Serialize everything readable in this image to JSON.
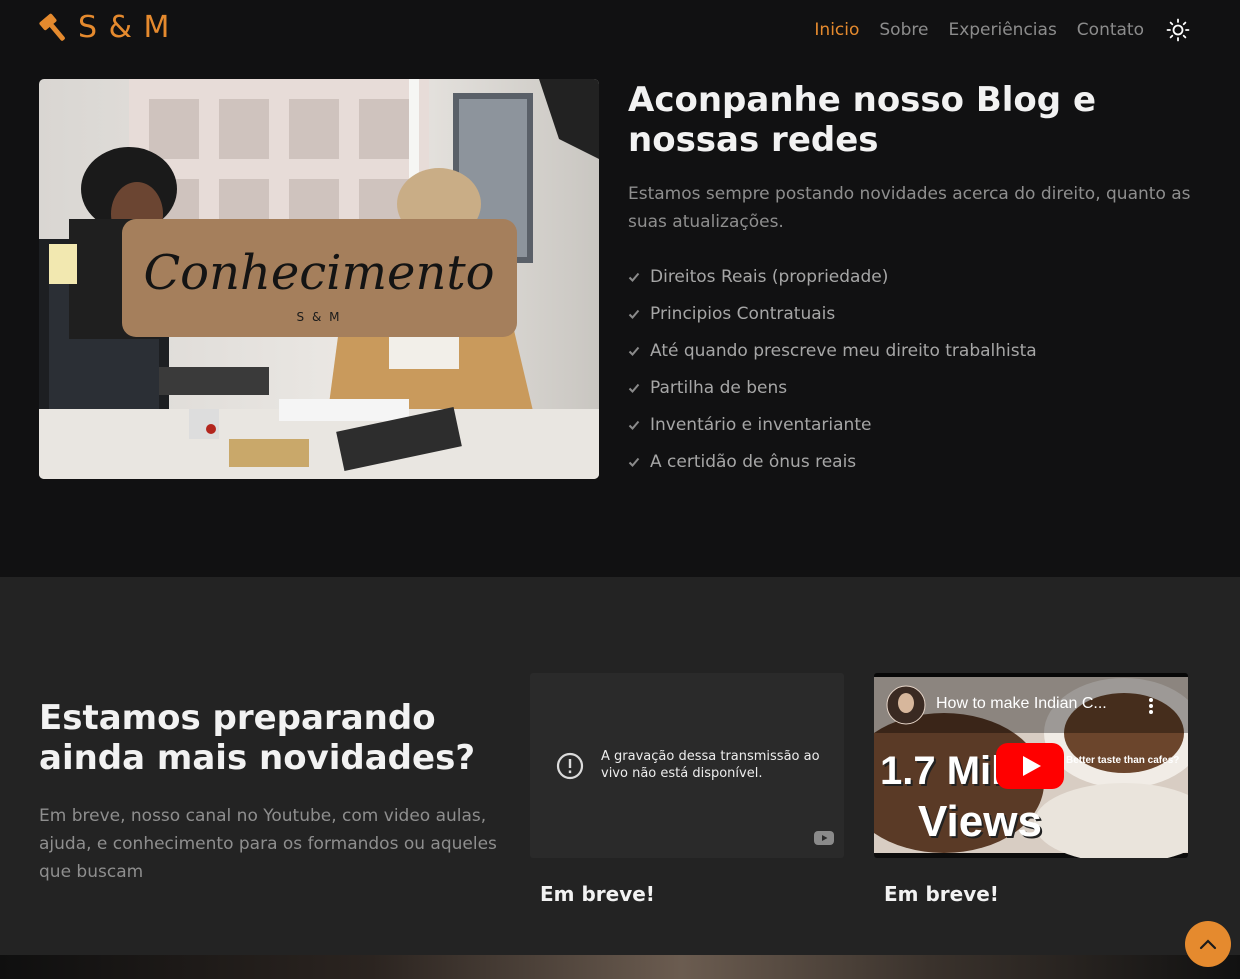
{
  "nav": {
    "logo_text": "S & M",
    "items": [
      {
        "label": "Inicio",
        "active": true
      },
      {
        "label": "Sobre",
        "active": false
      },
      {
        "label": "Experiências",
        "active": false
      },
      {
        "label": "Contato",
        "active": false
      }
    ],
    "theme_icon": "sun-icon"
  },
  "blog": {
    "image_card": {
      "script_text": "Conhecimento",
      "brand": "S & M"
    },
    "title": "Aconpanhe nosso Blog e nossas redes",
    "description": "Estamos sempre postando novidades acerca do direito, quanto as suas atualizações.",
    "topics": [
      "Direitos Reais (propriedade)",
      "Principios Contratuais",
      "Até quando prescreve meu direito trabalhista",
      "Partilha de bens",
      "Inventário e inventariante",
      "A certidão de ônus reais"
    ]
  },
  "news": {
    "title": "Estamos preparando ainda mais novidades?",
    "description": "Em breve, nosso canal no Youtube, com video aulas, ajuda, e conhecimento para os formandos ou aqueles que buscam",
    "videos": [
      {
        "message": "A gravação dessa transmissão ao vivo não está disponível.",
        "caption": "Em breve!"
      },
      {
        "title": "How to make Indian C...",
        "thumb_big": "1.7 Milli",
        "thumb_views": "Views",
        "thumb_side": "Better taste than cafes?",
        "caption": "Em breve!"
      }
    ]
  },
  "colors": {
    "accent": "#e58a2e",
    "background": "#111112",
    "section_alt": "#232323"
  }
}
